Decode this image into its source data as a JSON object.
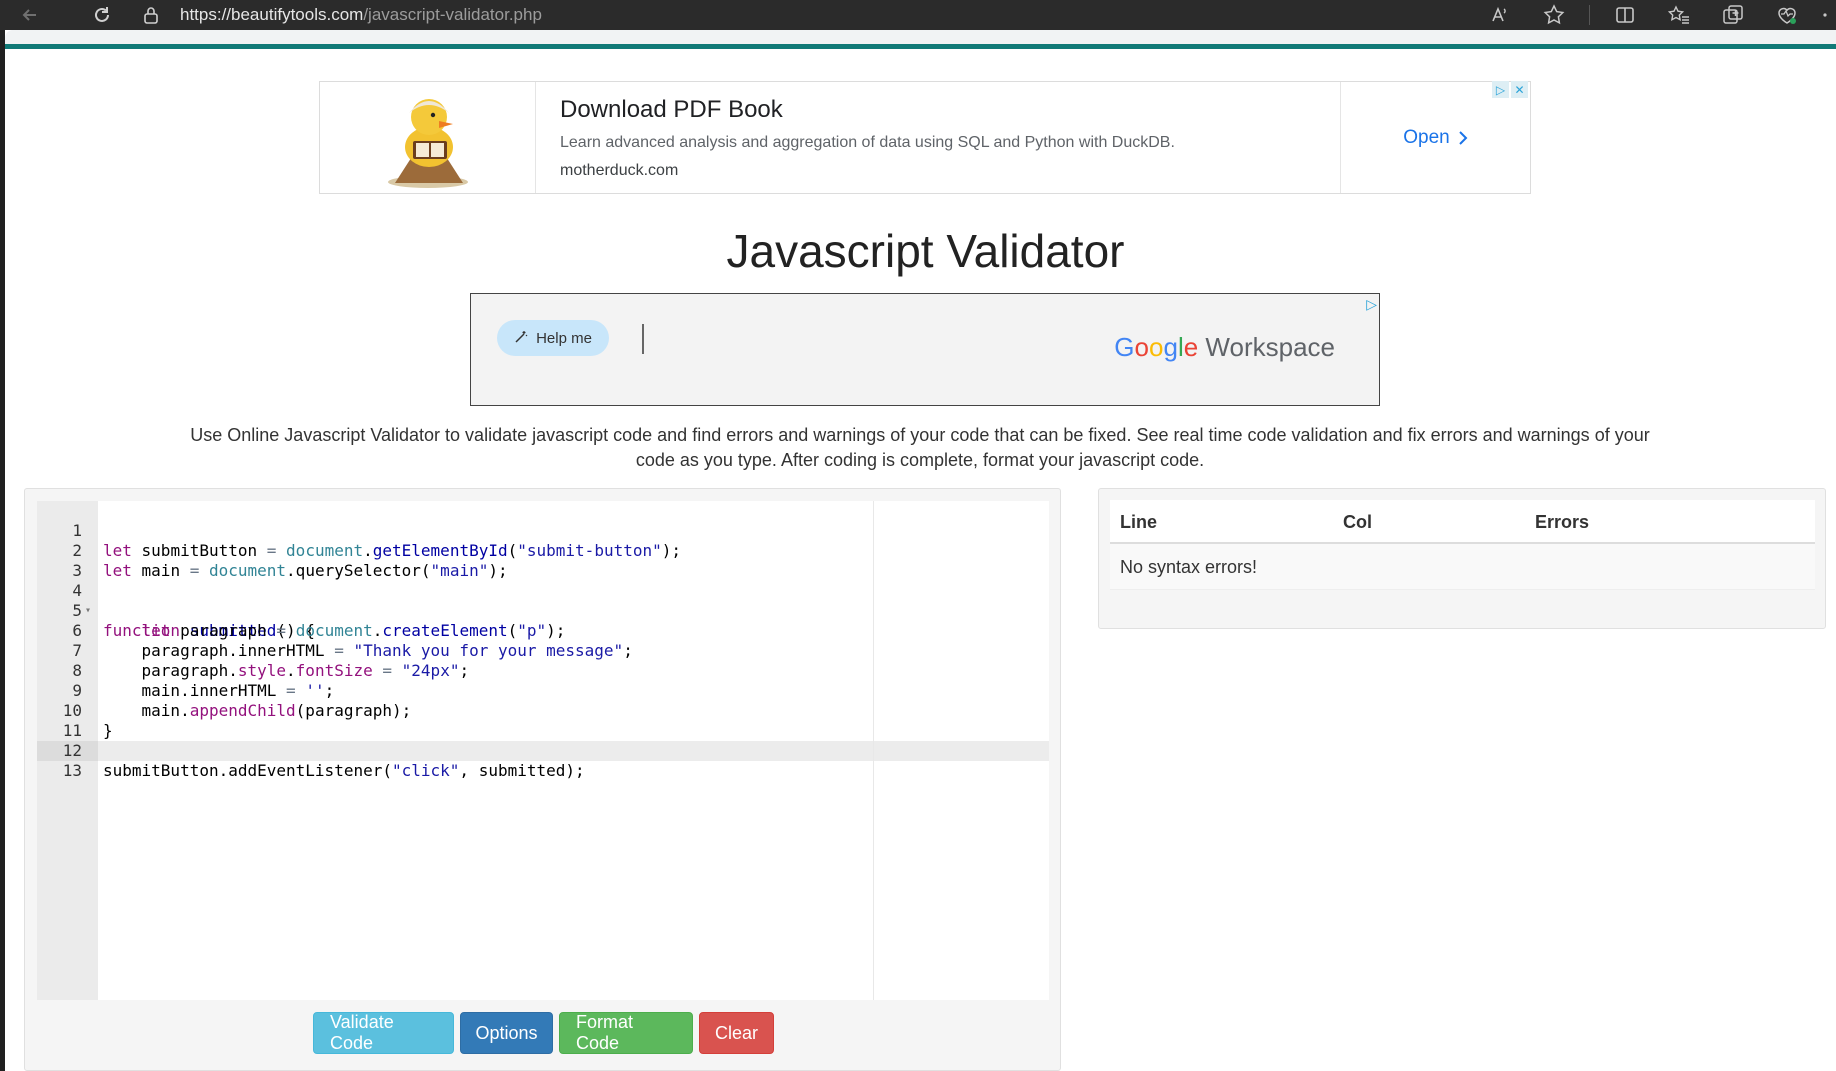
{
  "browser": {
    "url_host": "https://beautifytools.com",
    "url_path": "/javascript-validator.php",
    "icons": [
      "back-icon",
      "reload-icon",
      "lock-icon",
      "read-aloud-icon",
      "favorite-star-icon",
      "split-screen-icon",
      "favorites-icon",
      "collections-icon",
      "browser-essentials-icon"
    ]
  },
  "ad_top": {
    "title": "Download PDF Book",
    "description": "Learn advanced analysis and aggregation of data using SQL and Python with DuckDB.",
    "domain": "motherduck.com",
    "cta": "Open"
  },
  "page": {
    "title": "Javascript Validator",
    "description": "Use Online Javascript Validator to validate javascript code and find errors and warnings of your code that can be fixed. See real time code validation and fix errors and warnings of your code as you type. After coding is complete, format your javascript code."
  },
  "ad_mid": {
    "help_label": "Help me",
    "brand_google": "Google",
    "brand_product": "Workspace"
  },
  "editor": {
    "line_numbers": [
      "1",
      "2",
      "3",
      "4",
      "5",
      "6",
      "7",
      "8",
      "9",
      "10",
      "11",
      "12",
      "13"
    ],
    "lines": [
      "let submitButton = document.getElementById(\"submit-button\");",
      "let main = document.querySelector(\"main\");",
      "",
      "function submitted() {",
      "    let paragraph = document.createElement(\"p\");",
      "    paragraph.innerHTML = \"Thank you for your message\";",
      "    paragraph.style.fontSize = \"24px\";",
      "    main.innerHTML = '';",
      "    main.appendChild(paragraph);",
      "}",
      "",
      "submitButton.addEventListener(\"click\", submitted);",
      ""
    ]
  },
  "buttons": {
    "validate": "Validate Code",
    "options": "Options",
    "format": "Format Code",
    "clear": "Clear"
  },
  "errors": {
    "columns": [
      "Line",
      "Col",
      "Errors"
    ],
    "message": "No syntax errors!"
  }
}
